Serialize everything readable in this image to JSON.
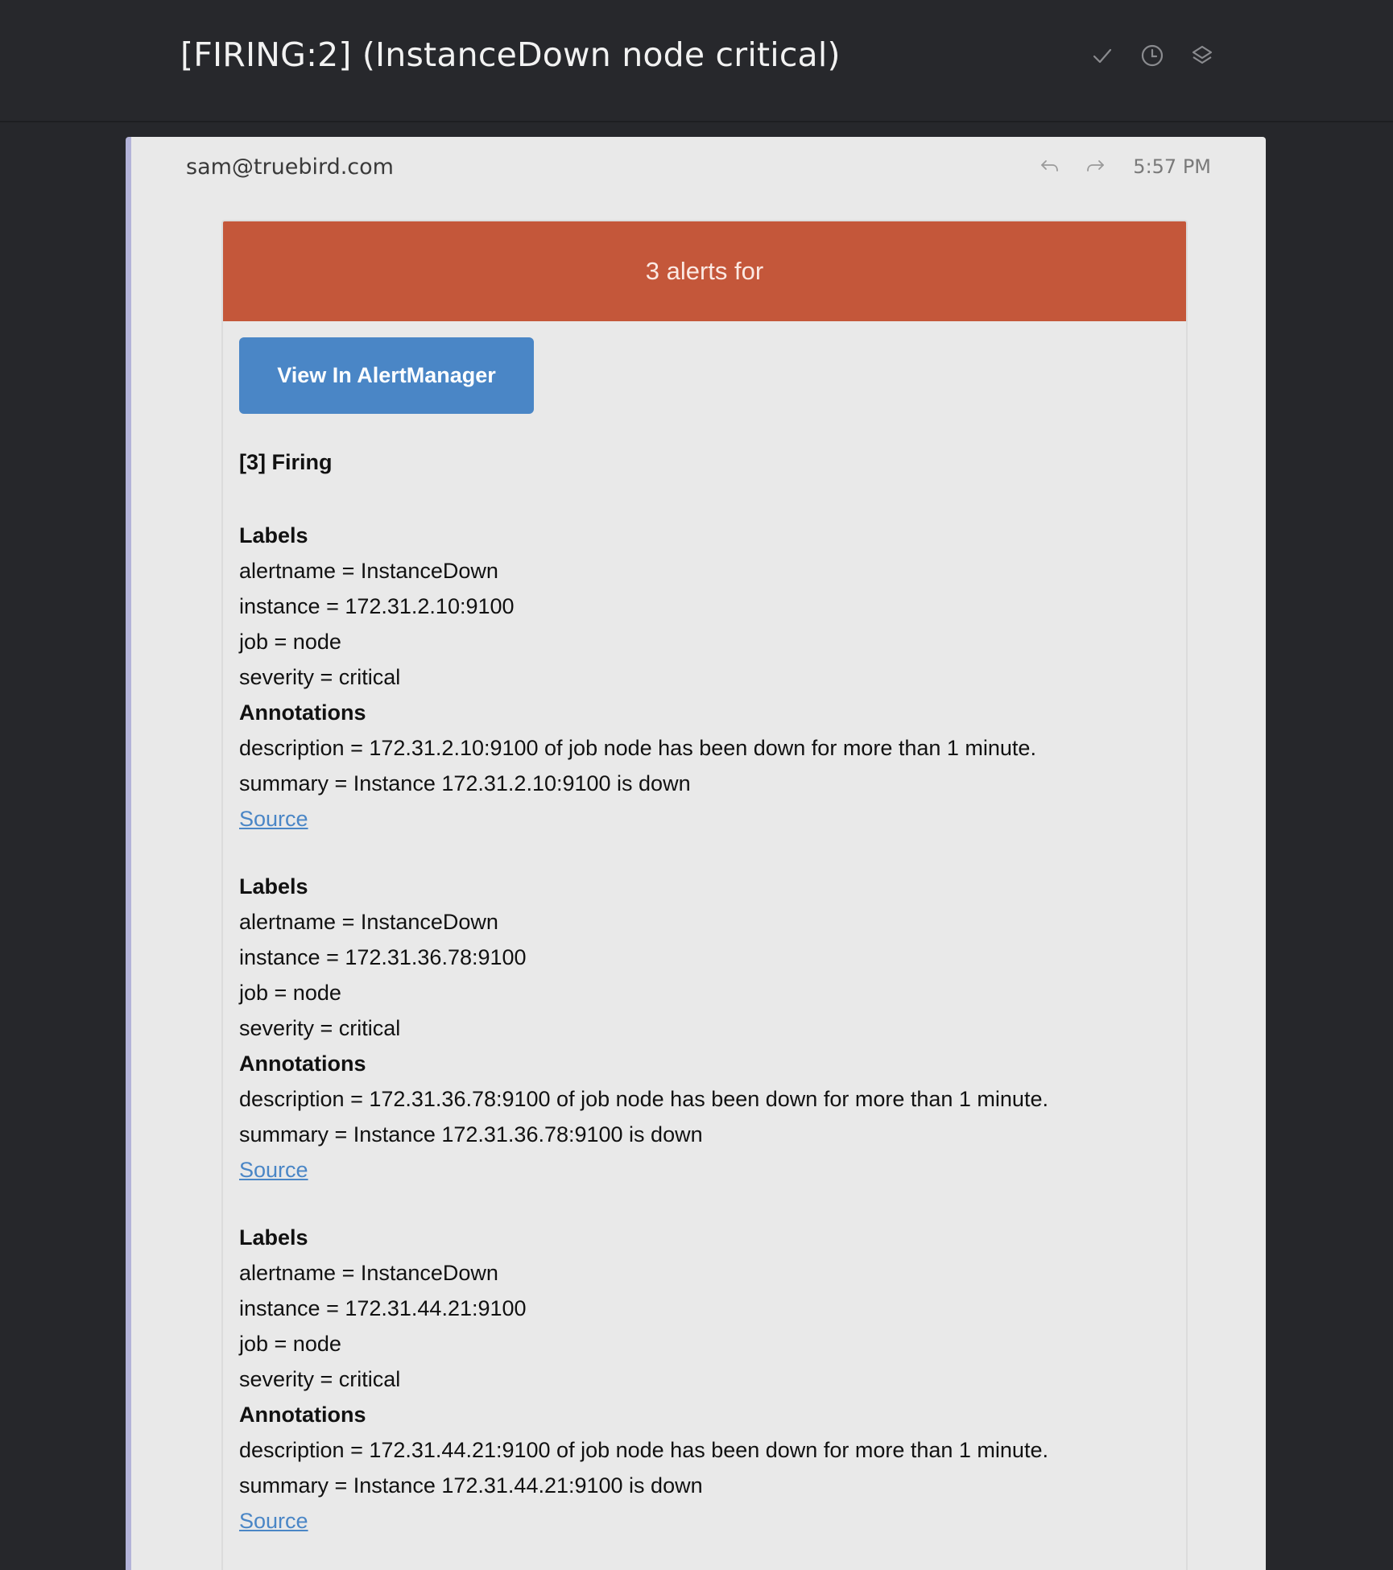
{
  "header": {
    "subject": "[FIRING:2] (InstanceDown node critical)",
    "actions": [
      "check-icon",
      "clock-icon",
      "layers-icon"
    ]
  },
  "message": {
    "sender": "sam@truebird.com",
    "time": "5:57 PM",
    "actions": [
      "reply-icon",
      "forward-icon"
    ]
  },
  "email": {
    "banner": "3 alerts for",
    "button_label": "View In AlertManager",
    "firing_heading": "[3] Firing",
    "labels_heading": "Labels",
    "annotations_heading": "Annotations",
    "source_label": "Source",
    "alerts": [
      {
        "alertname": "alertname = InstanceDown",
        "instance": "instance = 172.31.2.10:9100",
        "job": "job = node",
        "severity": "severity = critical",
        "description": "description = 172.31.2.10:9100 of job node has been down for more than 1 minute.",
        "summary": "summary = Instance 172.31.2.10:9100 is down"
      },
      {
        "alertname": "alertname = InstanceDown",
        "instance": "instance = 172.31.36.78:9100",
        "job": "job = node",
        "severity": "severity = critical",
        "description": "description = 172.31.36.78:9100 of job node has been down for more than 1 minute.",
        "summary": "summary = Instance 172.31.36.78:9100 is down"
      },
      {
        "alertname": "alertname = InstanceDown",
        "instance": "instance = 172.31.44.21:9100",
        "job": "job = node",
        "severity": "severity = critical",
        "description": "description = 172.31.44.21:9100 of job node has been down for more than 1 minute.",
        "summary": "summary = Instance 172.31.44.21:9100 is down"
      }
    ]
  },
  "colors": {
    "background": "#26272b",
    "banner": "#c4573a",
    "button": "#4a86c6",
    "link": "#4a86c6",
    "card": "#e9e9e9",
    "accent_border": "#b3b3d9"
  }
}
